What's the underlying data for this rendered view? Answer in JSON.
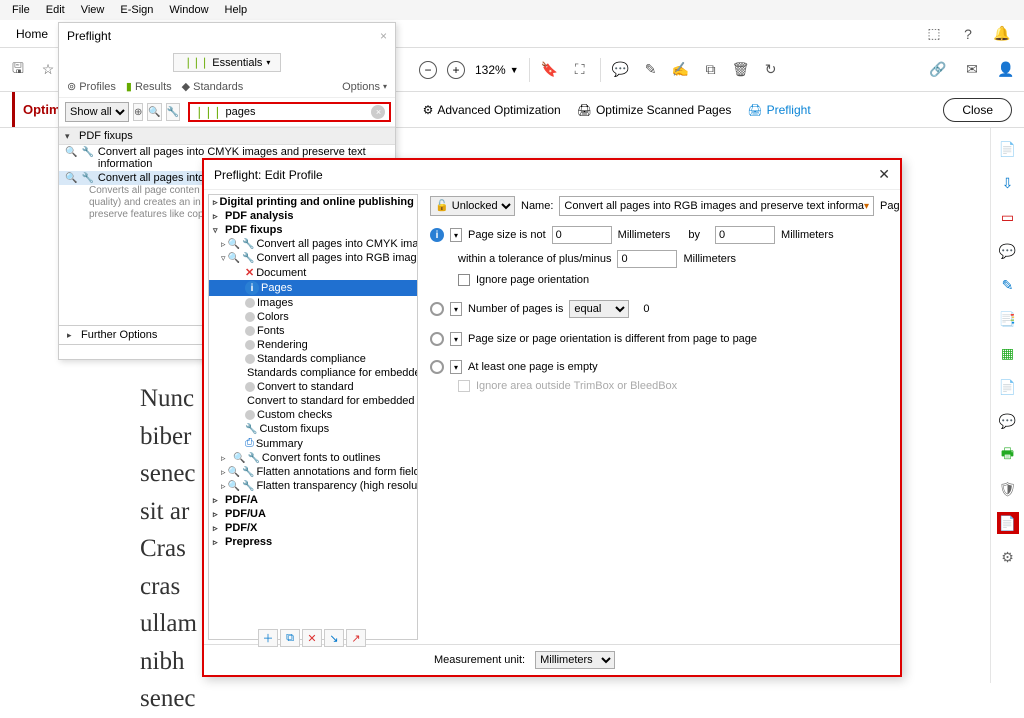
{
  "menubar": [
    "File",
    "Edit",
    "View",
    "E-Sign",
    "Window",
    "Help"
  ],
  "home": "Home",
  "toolbar": {
    "zoom": "132%"
  },
  "optimbar": {
    "label": "Optim",
    "adv": "Advanced Optimization",
    "scan": "Optimize Scanned Pages",
    "pre": "Preflight",
    "close": "Close"
  },
  "preflight": {
    "title": "Preflight",
    "essentials": "Essentials",
    "tabs": {
      "profiles": "Profiles",
      "results": "Results",
      "standards": "Standards",
      "options": "Options"
    },
    "showall": "Show all",
    "search_value": "pages",
    "section": "PDF fixups",
    "row1": "Convert all pages into CMYK images and preserve text information",
    "row2": "Convert all pages into RG",
    "desc": "Converts all page conten\nquality) and creates an in\npreserve features like cop",
    "further": "Further Options"
  },
  "dialog": {
    "title": "Preflight: Edit Profile",
    "unlocked": "Unlocked",
    "name_label": "Name:",
    "name_value": "Convert all pages into RGB images and preserve text informa",
    "pages_lbl": "Pages",
    "tree": {
      "n1": "Digital printing and online publishing",
      "n2": "PDF analysis",
      "n3": "PDF fixups",
      "n3a": "Convert all pages into CMYK images",
      "n3b": "Convert all pages into RGB images a",
      "doc": "Document",
      "pages": "Pages",
      "images": "Images",
      "colors": "Colors",
      "fonts": "Fonts",
      "rendering": "Rendering",
      "std": "Standards compliance",
      "stde": "Standards compliance for embedde",
      "conv": "Convert to standard",
      "conve": "Convert to standard for embedded",
      "cc": "Custom checks",
      "cf": "Custom fixups",
      "sum": "Summary",
      "cfo": "Convert fonts to outlines",
      "flat1": "Flatten annotations and form fields",
      "flat2": "Flatten transparency (high resolutio",
      "pdfa": "PDF/A",
      "pdfua": "PDF/UA",
      "pdfx": "PDF/X",
      "prepress": "Prepress"
    },
    "check1": {
      "label": "Page size is not",
      "v1": "0",
      "u1": "Millimeters",
      "by": "by",
      "v2": "0",
      "u2": "Millimeters",
      "tol": "within a tolerance of plus/minus",
      "tv": "0",
      "tu": "Millimeters",
      "ign": "Ignore page orientation"
    },
    "check2": {
      "label": "Number of pages is",
      "op": "equal",
      "v": "0"
    },
    "check3": {
      "label": "Page size or page orientation is different from page to page"
    },
    "check4": {
      "label": "At least one page is empty",
      "ign": "Ignore area outside TrimBox or BleedBox"
    },
    "mu_label": "Measurement unit:",
    "mu_value": "Millimeters"
  },
  "doc_text": "Nunc\nbiber\nsenec\nsit ar\nCras\ncras\nullam\nnibh\nsenec"
}
